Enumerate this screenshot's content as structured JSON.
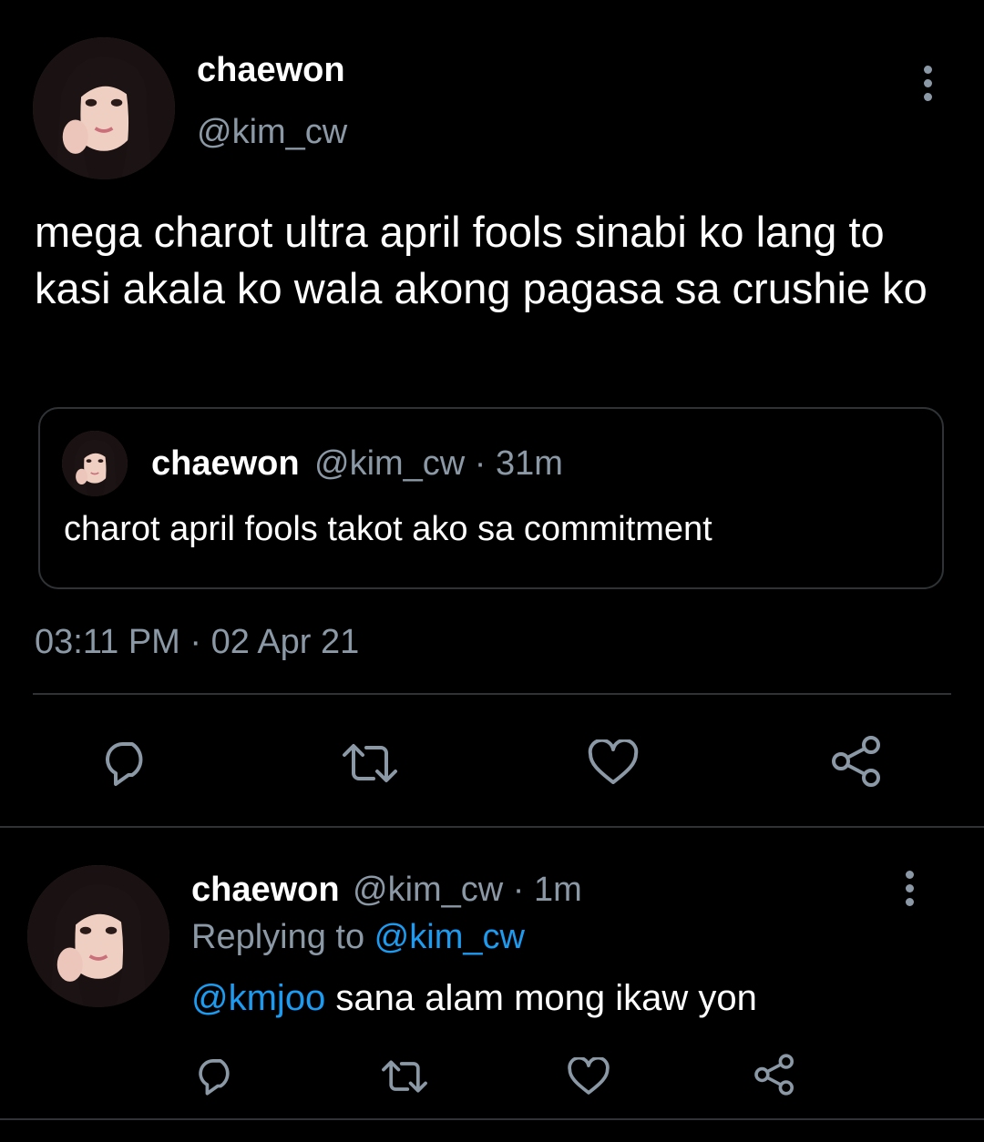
{
  "main_tweet": {
    "author_name": "chaewon",
    "author_handle": "@kim_cw",
    "text": "mega charot ultra april fools sinabi ko lang to kasi akala ko wala akong pagasa sa crushie ko",
    "timestamp": "03:11 PM · 02 Apr 21",
    "more_icon": "more-vertical-icon"
  },
  "quoted_tweet": {
    "author_name": "chaewon",
    "meta": "@kim_cw · 31m",
    "text": "charot april fools takot ako sa commitment"
  },
  "main_actions": {
    "reply_icon": "reply-icon",
    "retweet_icon": "retweet-icon",
    "like_icon": "like-icon",
    "share_icon": "share-icon"
  },
  "reply_tweet": {
    "author_name": "chaewon",
    "meta": "@kim_cw · 1m",
    "replying_prefix": "Replying to ",
    "replying_handle": "@kim_cw",
    "mention": "@kmjoo",
    "text": " sana alam mong ikaw yon",
    "more_icon": "more-vertical-icon"
  },
  "colors": {
    "background": "#000000",
    "text_primary": "#ffffff",
    "text_secondary": "#8b98a5",
    "accent": "#1d9bf0",
    "border": "#2f3336"
  }
}
